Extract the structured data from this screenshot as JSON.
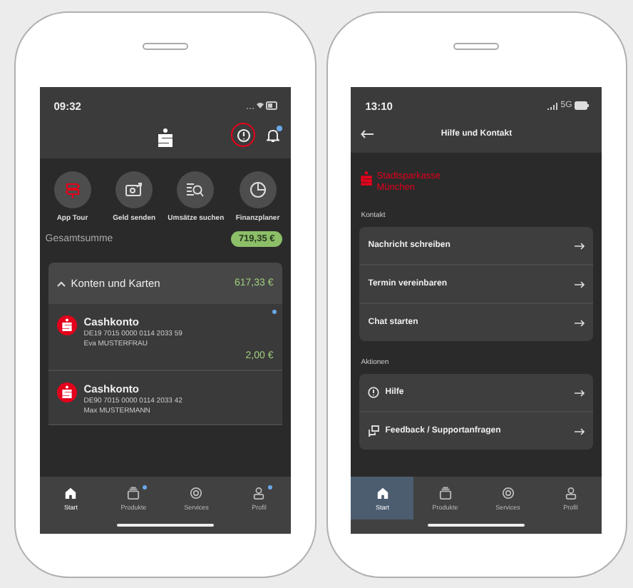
{
  "home_screen": {
    "time": "09:32",
    "help_button": {
      "circled": true
    },
    "bell": {
      "unread": true
    },
    "quick_actions": [
      {
        "label": "App Tour",
        "kind": "tour"
      },
      {
        "label": "Geld senden",
        "kind": "send"
      },
      {
        "label": "Umsätze suchen",
        "kind": "search"
      },
      {
        "label": "Finanzplaner",
        "kind": "planner"
      }
    ],
    "total": {
      "label": "Gesamtsumme",
      "amount": "719,35 €"
    },
    "accounts_section": {
      "title": "Konten und Karten",
      "amount": "617,33 €",
      "expanded": true,
      "accounts": [
        {
          "name": "Cashkonto",
          "iban": "DE19 7015 0000 0114 2033 59",
          "holder": "Eva MUSTERFRAU",
          "balance": "2,00 €",
          "unread": true
        },
        {
          "name": "Cashkonto",
          "iban": "DE90 7015 0000 0114 2033 42",
          "holder": "Max MUSTERMANN",
          "unread": false
        }
      ]
    },
    "nav": [
      {
        "label": "Start",
        "kind": "home",
        "selected": true,
        "highlighted": false,
        "badge": false
      },
      {
        "label": "Produkte",
        "kind": "products",
        "selected": false,
        "highlighted": false,
        "badge": true
      },
      {
        "label": "Services",
        "kind": "services",
        "selected": false,
        "highlighted": false,
        "badge": false
      },
      {
        "label": "Profil",
        "kind": "profile",
        "selected": false,
        "highlighted": false,
        "badge": true
      }
    ]
  },
  "help_screen": {
    "time": "13:10",
    "network": "5G",
    "title": "Hilfe und Kontakt",
    "bank_name": "Stadtsparkasse München",
    "sections": [
      {
        "title": "Kontakt",
        "items": [
          {
            "label": "Nachricht schreiben",
            "kind": "plain"
          },
          {
            "label": "Termin vereinbaren",
            "kind": "plain"
          },
          {
            "label": "Chat starten",
            "kind": "plain"
          }
        ]
      },
      {
        "title": "Aktionen",
        "items": [
          {
            "label": "Hilfe",
            "kind": "help"
          },
          {
            "label": "Feedback / Supportanfragen",
            "kind": "feedback"
          }
        ]
      }
    ],
    "nav": [
      {
        "label": "Start",
        "kind": "home",
        "selected": true,
        "highlighted": true,
        "badge": false
      },
      {
        "label": "Produkte",
        "kind": "products",
        "selected": false,
        "highlighted": false,
        "badge": false
      },
      {
        "label": "Services",
        "kind": "services",
        "selected": false,
        "highlighted": false,
        "badge": false
      },
      {
        "label": "Profil",
        "kind": "profile",
        "selected": false,
        "highlighted": false,
        "badge": false
      }
    ]
  }
}
